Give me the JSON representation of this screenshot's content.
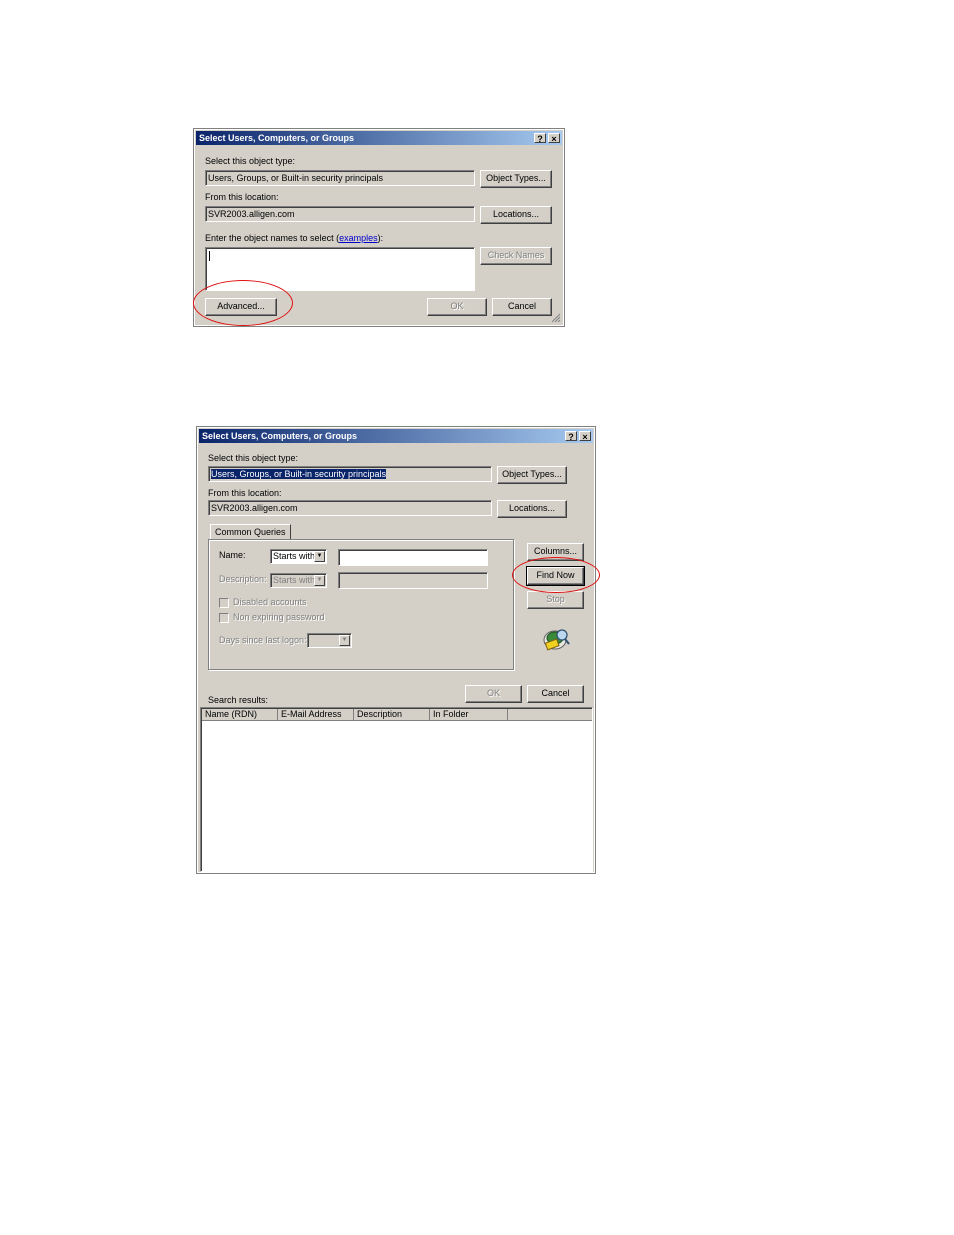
{
  "dialog1": {
    "title": "Select Users, Computers, or Groups",
    "help_label": "?",
    "close_label": "×",
    "object_type_label": "Select this object type:",
    "object_type_value": "Users, Groups, or Built-in security principals",
    "object_types_button": "Object Types...",
    "location_label": "From this location:",
    "location_value": "SVR2003.alligen.com",
    "locations_button": "Locations...",
    "names_label": "Enter the object names to select (",
    "names_link": "examples",
    "names_label_end": "):",
    "names_value": "",
    "check_names_button": "Check Names",
    "advanced_button": "Advanced...",
    "ok_button": "OK",
    "cancel_button": "Cancel"
  },
  "dialog2": {
    "title": "Select Users, Computers, or Groups",
    "help_label": "?",
    "close_label": "×",
    "object_type_label": "Select this object type:",
    "object_type_value": "Users, Groups, or Built-in security principals",
    "object_types_button": "Object Types...",
    "location_label": "From this location:",
    "location_value": "SVR2003.alligen.com",
    "locations_button": "Locations...",
    "tab_label": "Common Queries",
    "name_label": "Name:",
    "name_mode": "Starts with",
    "name_value": "",
    "description_label": "Description:",
    "description_mode": "Starts with",
    "description_value": "",
    "disabled_accounts_label": "Disabled accounts",
    "non_expiring_label": "Non expiring password",
    "days_since_logon_label": "Days since last logon:",
    "days_since_logon_value": "",
    "columns_button": "Columns...",
    "find_now_button": "Find Now",
    "stop_button": "Stop",
    "ok_button": "OK",
    "cancel_button": "Cancel",
    "search_results_label": "Search results:",
    "columns": [
      "Name (RDN)",
      "E-Mail Address",
      "Description",
      "In Folder"
    ]
  },
  "colors": {
    "highlight_circle": "#e01010",
    "title_bar": "#0a246a",
    "dialog_face": "#d4d0c8"
  }
}
